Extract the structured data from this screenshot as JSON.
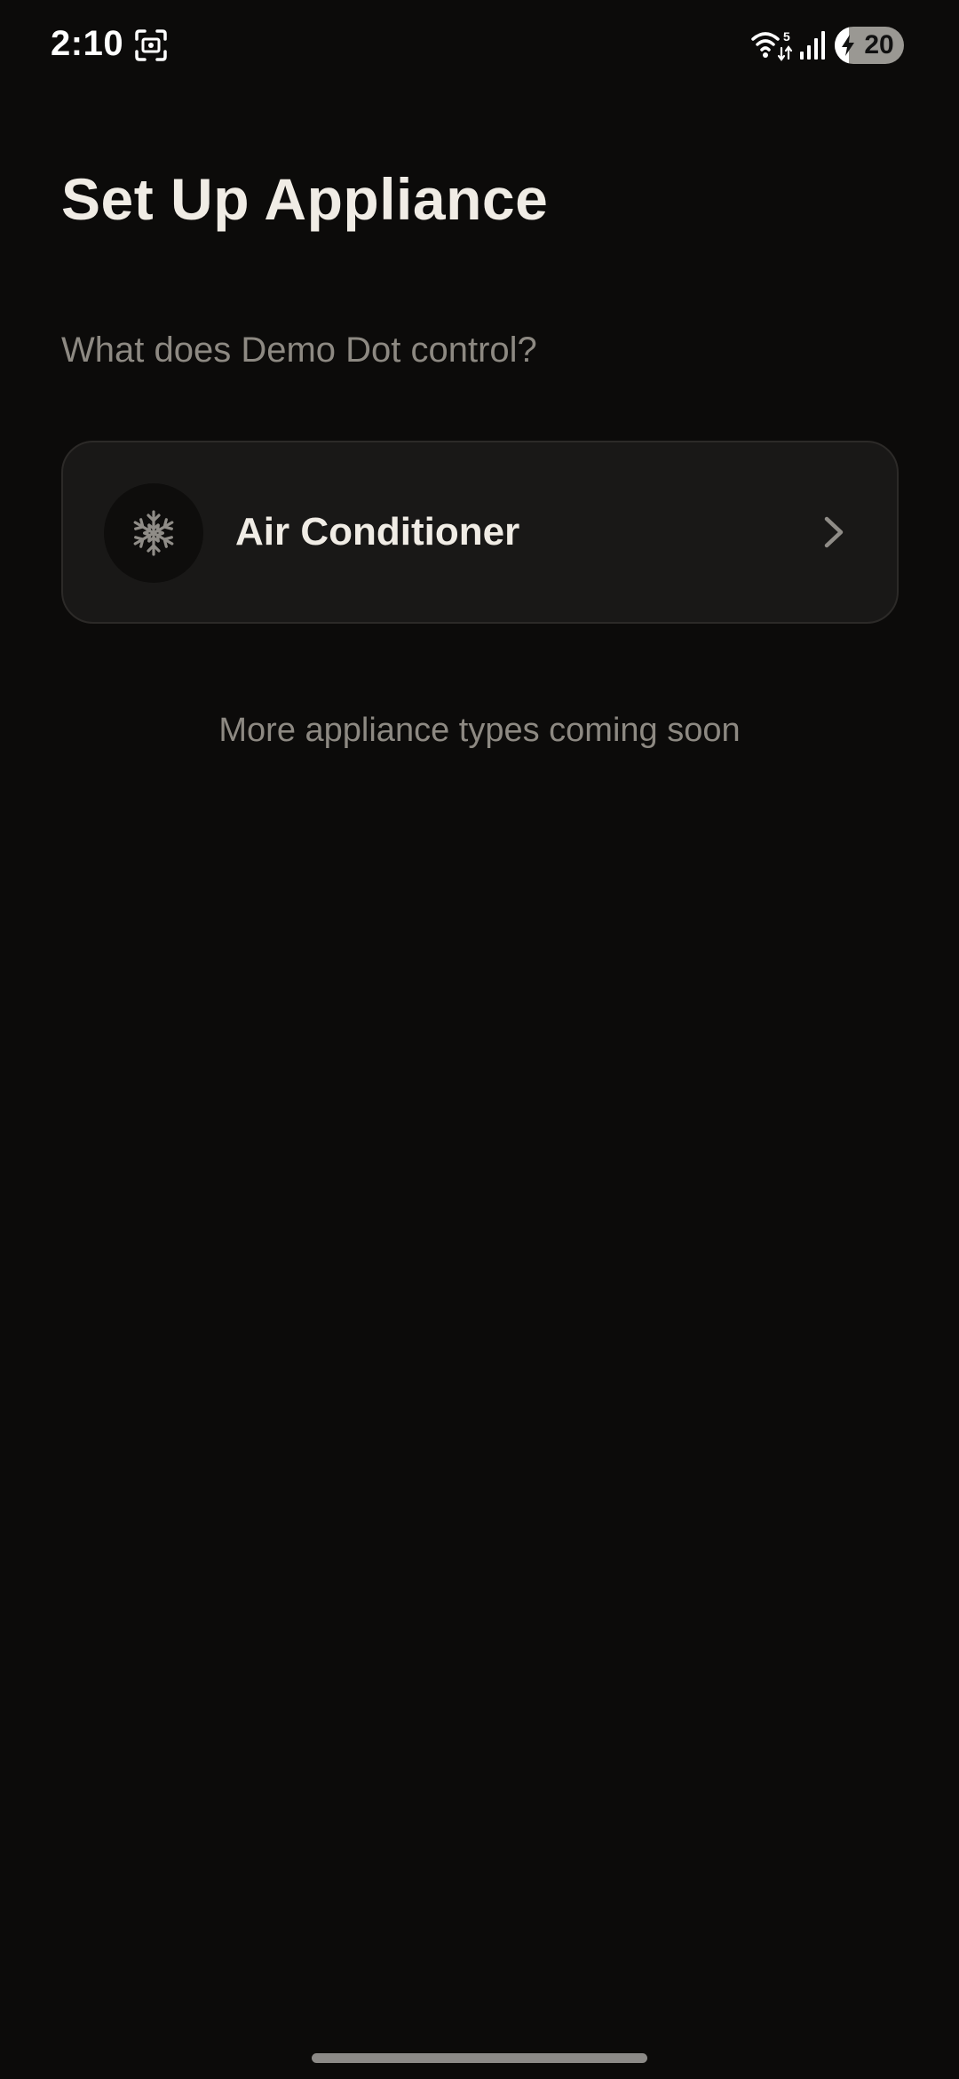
{
  "status_bar": {
    "time": "2:10",
    "wifi_badge": "5",
    "battery_level": "20",
    "battery_fraction": 0.2,
    "icons": [
      "screenshot-icon",
      "wifi-icon",
      "signal-icon",
      "battery-icon",
      "charging-bolt-icon"
    ]
  },
  "header": {
    "title": "Set Up Appliance",
    "subtitle": "What does Demo Dot control?"
  },
  "appliances": [
    {
      "label": "Air Conditioner",
      "icon": "snowflake-icon",
      "action_icon": "chevron-right-icon"
    }
  ],
  "footnote": "More appliance types coming soon",
  "colors": {
    "background": "#0c0b0a",
    "card": "#191817",
    "card_border": "#2c2a28",
    "text_primary": "#f0ece5",
    "text_secondary": "#8d8982"
  }
}
